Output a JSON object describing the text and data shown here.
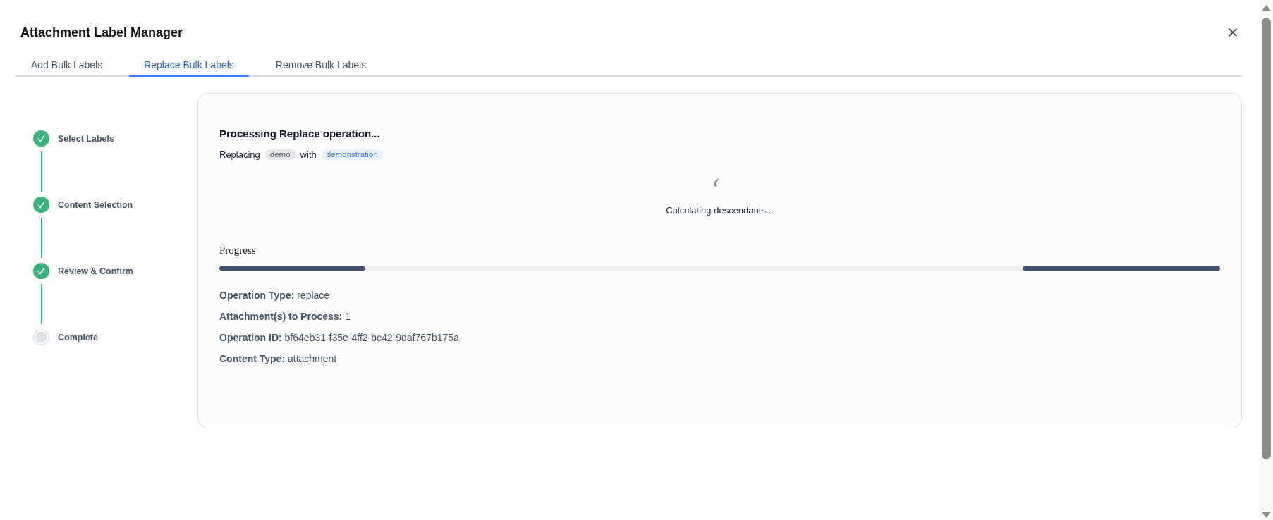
{
  "dialog": {
    "title": "Attachment Label Manager"
  },
  "tabs": [
    {
      "label": "Add Bulk Labels",
      "selected": false
    },
    {
      "label": "Replace Bulk Labels",
      "selected": true
    },
    {
      "label": "Remove Bulk Labels",
      "selected": false
    }
  ],
  "steps": [
    {
      "label": "Select Labels",
      "completed": true
    },
    {
      "label": "Content Selection",
      "completed": true
    },
    {
      "label": "Review & Confirm",
      "completed": true
    },
    {
      "label": "Complete",
      "completed": false
    }
  ],
  "operation": {
    "title": "Processing Replace operation...",
    "summary": {
      "prefix": "Replacing",
      "old_label": "demo",
      "joiner": "with",
      "new_label": "demonstration"
    },
    "status": {
      "loading": true,
      "message": "Calculating descendants..."
    },
    "progress": {
      "label": "Progress",
      "indeterminate": true
    },
    "details": [
      {
        "label": "Operation Type:",
        "value": "replace"
      },
      {
        "label": "Attachment(s) to Process:",
        "value": "1"
      },
      {
        "label": "Operation ID:",
        "value": "bf64eb31-f35e-4ff2-bc42-9daf767b175a"
      },
      {
        "label": "Content Type:",
        "value": "attachment"
      }
    ]
  }
}
